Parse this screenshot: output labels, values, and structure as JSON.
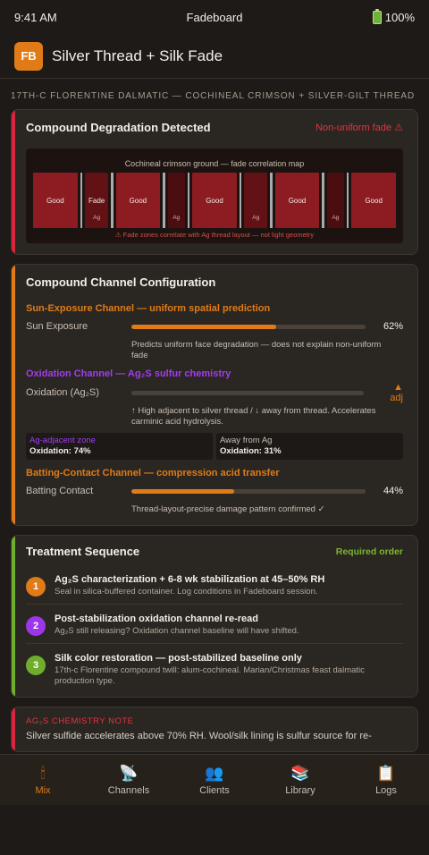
{
  "status": {
    "time": "9:41 AM",
    "carrier": "Fadeboard",
    "battery": "100%"
  },
  "header": {
    "logo": "FB",
    "title": "Silver Thread + Silk Fade"
  },
  "subtitle": "17th-c Florentine dalmatic — cochineal crimson + silver-gilt thread",
  "degradation": {
    "title": "Compound Degradation Detected",
    "tag": "Non-uniform fade ⚠",
    "map_caption": "Cochineal crimson ground — fade correlation map",
    "segments": [
      {
        "kind": "good",
        "label": "Good",
        "sub": ""
      },
      {
        "kind": "fade",
        "label": "Fade",
        "sub": "Ag"
      },
      {
        "kind": "good",
        "label": "Good",
        "sub": ""
      },
      {
        "kind": "ag",
        "label": "",
        "sub": "Ag"
      },
      {
        "kind": "good",
        "label": "Good",
        "sub": ""
      },
      {
        "kind": "fade",
        "label": "",
        "sub": "Ag"
      },
      {
        "kind": "good",
        "label": "Good",
        "sub": ""
      },
      {
        "kind": "ag",
        "label": "",
        "sub": "Ag"
      },
      {
        "kind": "good",
        "label": "Good",
        "sub": ""
      }
    ],
    "warning": "⚠ Fade zones correlate with Ag thread layout — not light geometry"
  },
  "config": {
    "title": "Compound Channel Configuration",
    "sun": {
      "title": "Sun-Exposure Channel — uniform spatial prediction",
      "label": "Sun Exposure",
      "value": 0.62,
      "value_text": "62%",
      "note": "Predicts uniform face degradation — does not explain non-uniform fade"
    },
    "oxidation": {
      "title": "Oxidation Channel — Ag₂S sulfur chemistry",
      "label": "Oxidation (Ag₂S)",
      "value_text": "▲ adj",
      "note": "↑ High adjacent to silver thread / ↓ away from thread. Accelerates carminic acid hydrolysis.",
      "zone_a_label": "Ag-adjacent zone",
      "zone_a_value": "Oxidation: 74%",
      "zone_b_label": "Away from Ag",
      "zone_b_value": "Oxidation: 31%"
    },
    "batting": {
      "title": "Batting-Contact Channel — compression acid transfer",
      "label": "Batting Contact",
      "value": 0.44,
      "value_text": "44%",
      "note": "Thread-layout-precise damage pattern confirmed ✓"
    }
  },
  "treatment": {
    "title": "Treatment Sequence",
    "tag": "Required order",
    "steps": [
      {
        "num": "1",
        "color": "#e07b17",
        "title": "Ag₂S characterization + 6-8 wk stabilization at 45–50% RH",
        "desc": "Seal in silica-buffered container. Log conditions in Fadeboard session."
      },
      {
        "num": "2",
        "color": "#9d36e6",
        "title": "Post-stabilization oxidation channel re-read",
        "desc": "Ag₂S still releasing? Oxidation channel baseline will have shifted."
      },
      {
        "num": "3",
        "color": "#6fae2c",
        "title": "Silk color restoration — post-stabilized baseline only",
        "desc": "17th-c Florentine compound twill: alum-cochineal. Marian/Christmas feast dalmatic production type."
      }
    ]
  },
  "chem_note": {
    "title": "Ag₂S chemistry note",
    "body": "Silver sulfide accelerates above 70% RH. Wool/silk lining is sulfur source for re-"
  },
  "tabs": [
    {
      "label": "Mix",
      "icon": "🕯",
      "icon_name": "mix-icon"
    },
    {
      "label": "Channels",
      "icon": "📡",
      "icon_name": "channels-icon"
    },
    {
      "label": "Clients",
      "icon": "👥",
      "icon_name": "clients-icon"
    },
    {
      "label": "Library",
      "icon": "📚",
      "icon_name": "library-icon"
    },
    {
      "label": "Logs",
      "icon": "📋",
      "icon_name": "logs-icon"
    }
  ]
}
